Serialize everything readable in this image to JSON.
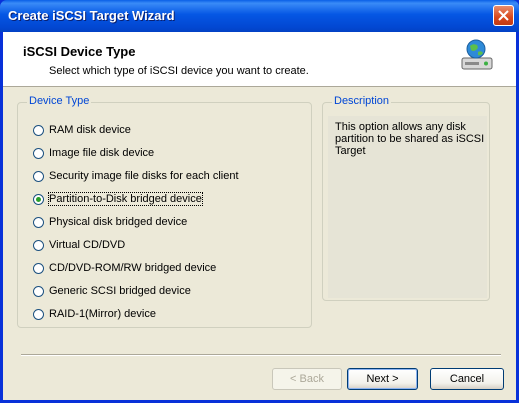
{
  "window": {
    "title": "Create iSCSI Target Wizard"
  },
  "header": {
    "title": "iSCSI Device Type",
    "subtitle": "Select which type of iSCSI device you want to create.",
    "icon": "network-disk-icon"
  },
  "device_type": {
    "legend": "Device Type",
    "selected_index": 3,
    "options": [
      "RAM disk device",
      "Image file disk device",
      "Security image file disks for each client",
      "Partition-to-Disk bridged device",
      "Physical disk bridged device",
      "Virtual CD/DVD",
      "CD/DVD-ROM/RW bridged device",
      "Generic SCSI bridged device",
      "RAID-1(Mirror) device"
    ]
  },
  "description": {
    "legend": "Description",
    "text": "This option allows any disk partition to be shared as iSCSI Target"
  },
  "buttons": {
    "back": "< Back",
    "next": "Next >",
    "cancel": "Cancel"
  },
  "colors": {
    "titlebar": "#0553e1",
    "legend": "#0046d5",
    "radio_dot": "#2a9f2a"
  }
}
